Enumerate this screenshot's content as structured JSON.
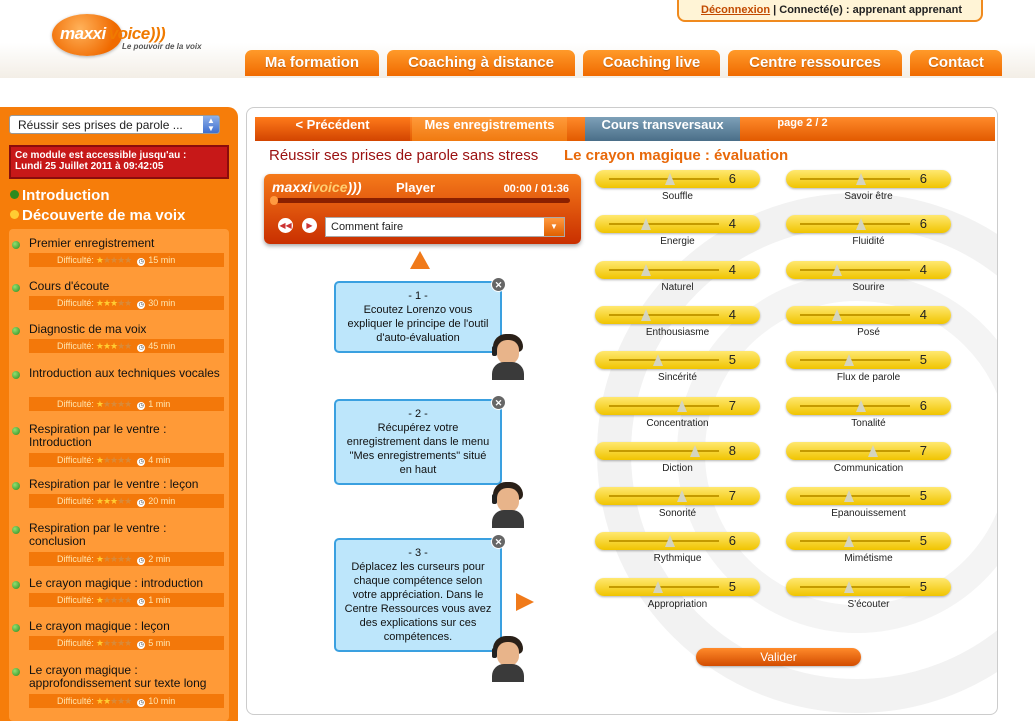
{
  "logo": {
    "brand_a": "maxxi",
    "brand_b": "voice",
    "tagline": "Le pouvoir de la voix"
  },
  "header": {
    "logout_label": "Déconnexion",
    "connected_text": " | Connecté(e) : apprenant apprenant"
  },
  "nav": [
    {
      "label": "Ma formation"
    },
    {
      "label": "Coaching à distance"
    },
    {
      "label": "Coaching live"
    },
    {
      "label": "Centre ressources"
    },
    {
      "label": "Contact"
    }
  ],
  "sidebar": {
    "module_select": "Réussir ses prises de parole ...",
    "access_line1": "Ce module est accessible jusqu'au :",
    "access_line2": "Lundi 25 Juillet 2011 à 09:42:05",
    "sections": [
      {
        "label": "Introduction",
        "color": "#2e8a1e"
      },
      {
        "label": "Découverte de ma voix",
        "color": "#ffcc33"
      }
    ],
    "difficulty_label": "Difficulté:",
    "items": [
      {
        "title": "Premier enregistrement",
        "stars": 1,
        "duration": "15 min"
      },
      {
        "title": "Cours d'écoute",
        "stars": 3,
        "duration": "30 min"
      },
      {
        "title": "Diagnostic de ma voix",
        "stars": 3,
        "duration": "45 min"
      },
      {
        "title": "Introduction aux techniques vocales",
        "stars": 1,
        "duration": "1 min"
      },
      {
        "title": "Respiration par le ventre : Introduction",
        "stars": 1,
        "duration": "4 min"
      },
      {
        "title": "Respiration par le ventre : leçon",
        "stars": 3,
        "duration": "20 min"
      },
      {
        "title": "Respiration par le ventre : conclusion",
        "stars": 1,
        "duration": "2 min"
      },
      {
        "title": "Le crayon magique : introduction",
        "stars": 1,
        "duration": "1 min"
      },
      {
        "title": "Le crayon magique : leçon",
        "stars": 1,
        "duration": "5 min"
      },
      {
        "title": "Le crayon magique : approfondissement sur texte long",
        "stars": 2,
        "duration": "10 min"
      }
    ]
  },
  "main": {
    "tabs": {
      "prev": "< Précédent",
      "recordings": "Mes enregistrements",
      "transversal": "Cours transversaux",
      "page": "page 2 / 2"
    },
    "title": "Réussir ses prises de parole sans stress",
    "subtitle": "Le crayon magique : évaluation",
    "player": {
      "brand_a": "maxxi",
      "brand_b": "voice",
      "name": "Player",
      "time": "00:00 / 01:36",
      "dropdown": "Comment faire",
      "progress": 0
    },
    "steps": [
      {
        "num": "- 1 -",
        "text": "Ecoutez Lorenzo vous expliquer le principe de l'outil d'auto-évaluation"
      },
      {
        "num": "- 2 -",
        "text": "Récupérez votre enregistrement dans le menu \"Mes enregistrements\" situé en haut"
      },
      {
        "num": "- 3 -",
        "text": "Déplacez les curseurs pour chaque compétence selon votre appréciation. Dans le Centre Ressources vous avez des explications sur ces compétences."
      }
    ],
    "skills_left": [
      {
        "label": "Souffle",
        "value": 6
      },
      {
        "label": "Energie",
        "value": 4
      },
      {
        "label": "Naturel",
        "value": 4
      },
      {
        "label": "Enthousiasme",
        "value": 4
      },
      {
        "label": "Sincérité",
        "value": 5
      },
      {
        "label": "Concentration",
        "value": 7
      },
      {
        "label": "Diction",
        "value": 8
      },
      {
        "label": "Sonorité",
        "value": 7
      },
      {
        "label": "Rythmique",
        "value": 6
      },
      {
        "label": "Appropriation",
        "value": 5
      }
    ],
    "skills_right": [
      {
        "label": "Savoir être",
        "value": 6
      },
      {
        "label": "Fluidité",
        "value": 6
      },
      {
        "label": "Sourire",
        "value": 4
      },
      {
        "label": "Posé",
        "value": 4
      },
      {
        "label": "Flux de parole",
        "value": 5
      },
      {
        "label": "Tonalité",
        "value": 6
      },
      {
        "label": "Communication",
        "value": 7
      },
      {
        "label": "Epanouissement",
        "value": 5
      },
      {
        "label": "Mimétisme",
        "value": 5
      },
      {
        "label": "S'écouter",
        "value": 5
      }
    ],
    "validate_label": "Valider"
  }
}
